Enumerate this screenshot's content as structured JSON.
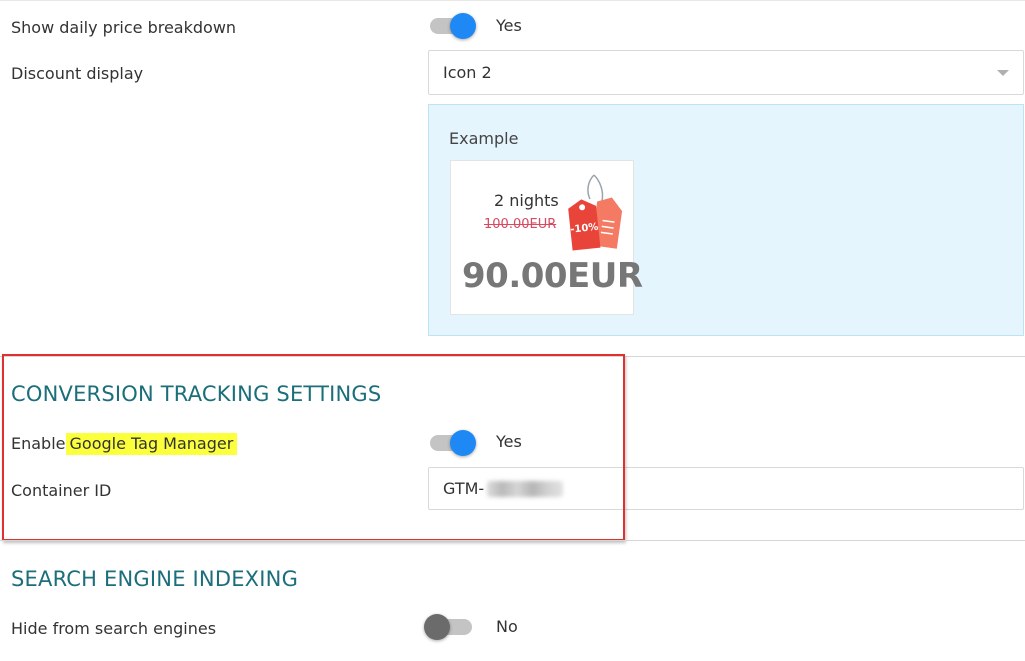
{
  "daily_breakdown": {
    "label": "Show daily price breakdown",
    "value_text": "Yes",
    "enabled": true
  },
  "discount_display": {
    "label": "Discount display",
    "selected": "Icon 2"
  },
  "example": {
    "title": "Example",
    "nights": "2 nights",
    "old_price": "100.00EUR",
    "new_price": "90.00EUR",
    "tag_text": "-10%"
  },
  "conversion": {
    "title": "CONVERSION TRACKING SETTINGS",
    "gtm_label_prefix": "Enable",
    "gtm_label_highlight": "Google Tag Manager",
    "gtm_value_text": "Yes",
    "gtm_enabled": true,
    "container_label": "Container ID",
    "container_value": "GTM-"
  },
  "indexing": {
    "title": "SEARCH ENGINE INDEXING",
    "hide_label": "Hide from search engines",
    "hide_value_text": "No",
    "hide_enabled": false
  },
  "colors": {
    "accent": "#1e88f5",
    "section_title": "#1b6e7a",
    "highlight": "#fbff3c",
    "annotation_box": "#e03131",
    "example_bg": "#e5f5fd",
    "tag_red": "#f15a4a"
  }
}
